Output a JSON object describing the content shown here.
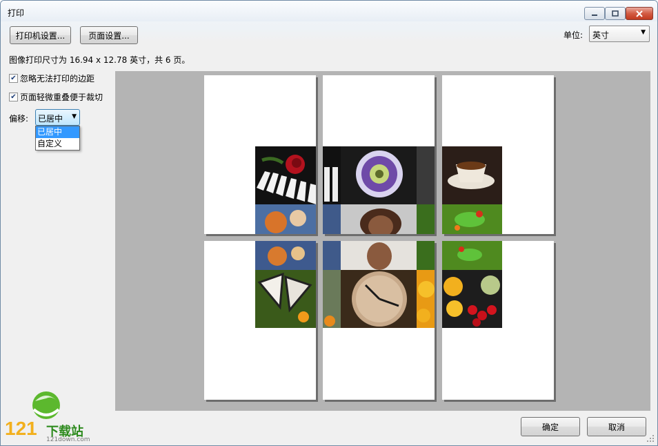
{
  "window": {
    "title": "打印"
  },
  "toolbar": {
    "printer_settings": "打印机设置...",
    "page_settings": "页面设置...",
    "unit_label": "单位:",
    "unit_value": "英寸"
  },
  "info_text": "图像打印尺寸为 16.94 x 12.78 英寸，共 6 页。",
  "options": {
    "ignore_margins": {
      "label": "忽略无法打印的边距",
      "checked": true
    },
    "overlap_pages": {
      "label": "页面轻微重叠便于裁切",
      "checked": true
    }
  },
  "offset": {
    "label": "偏移:",
    "value": "已居中",
    "options": [
      "已居中",
      "自定义"
    ]
  },
  "buttons": {
    "ok": "确定",
    "cancel": "取消"
  },
  "watermark": {
    "brand": "121",
    "name": "下载站",
    "url": "121down.com"
  }
}
